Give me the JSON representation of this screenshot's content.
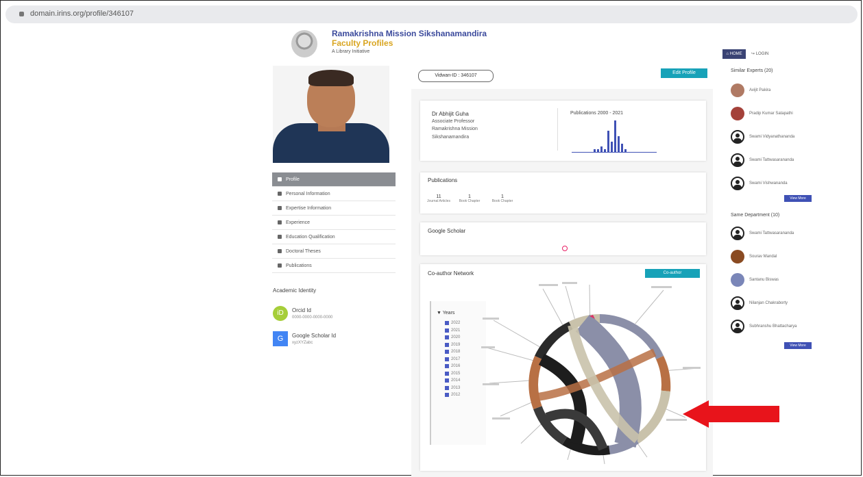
{
  "browser": {
    "url": "domain.irins.org/profile/346107"
  },
  "header": {
    "title": "Ramakrishna Mission Sikshanamandira",
    "subtitle": "Faculty Profiles",
    "tagline": "A Library Initiative"
  },
  "nav": {
    "home": "HOME",
    "login": "LOGIN"
  },
  "sidebar": {
    "items": [
      {
        "label": "Profile",
        "active": true
      },
      {
        "label": "Personal Information"
      },
      {
        "label": "Expertise Information"
      },
      {
        "label": "Experience"
      },
      {
        "label": "Education Qualification"
      },
      {
        "label": "Doctoral Theses"
      },
      {
        "label": "Publications"
      }
    ],
    "academic_identity": "Academic Identity",
    "orcid": {
      "label": "Orcid Id",
      "value": "0000-0000-0000-0000"
    },
    "google_scholar": {
      "label": "Google Scholar Id",
      "value": "xyzXYZabc"
    }
  },
  "profile": {
    "vidwan_id": "Vidwan-ID : 346107",
    "edit_label": "Edit Profile",
    "name": "Dr Abhijit Guha",
    "designation": "Associate Professor",
    "org_line1": "Ramakrishna Mission",
    "org_line2": "Sikshanamandira",
    "publications_chart_title": "Publications 2000 - 2021"
  },
  "publications": {
    "title": "Publications",
    "stats": [
      {
        "value": "11",
        "label": "Journal Articles"
      },
      {
        "value": "1",
        "label": "Book Chapter"
      },
      {
        "value": "1",
        "label": "Book Chapter"
      }
    ]
  },
  "google_scholar": {
    "title": "Google Scholar"
  },
  "coauthor": {
    "title": "Co-author Network",
    "button": "Co-author",
    "years_label": "Years",
    "years": [
      "2022",
      "2021",
      "2020",
      "2019",
      "2018",
      "2017",
      "2016",
      "2015",
      "2014",
      "2013",
      "2012"
    ]
  },
  "right_panel": {
    "similar_experts": "Similar Experts (20)",
    "experts": [
      {
        "name": "Avijit Pakira",
        "avatar": "photo",
        "color": "#b07a64"
      },
      {
        "name": "Pradip Kumar Satapathi",
        "avatar": "photo",
        "color": "#a4413a"
      },
      {
        "name": "Swami Vidyanathananda",
        "avatar": "generic"
      },
      {
        "name": "Swami Tattwasarananda",
        "avatar": "generic"
      },
      {
        "name": "Swami Vishwananda",
        "avatar": "generic"
      }
    ],
    "view_more": "View More",
    "same_department": "Same Department (10)",
    "dept_people": [
      {
        "name": "Swami Tattwasarananda",
        "avatar": "generic"
      },
      {
        "name": "Sourav Mandal",
        "avatar": "photo",
        "color": "#8a4b22"
      },
      {
        "name": "Santanu Biswas",
        "avatar": "photo",
        "color": "#7a86b8"
      },
      {
        "name": "Nilanjan Chakraborty",
        "avatar": "generic"
      },
      {
        "name": "Subhranshu Bhattacharya",
        "avatar": "generic"
      }
    ]
  },
  "pub_histogram": {
    "values": [
      1,
      1,
      2,
      1,
      8,
      4,
      12,
      6,
      3,
      1
    ]
  }
}
